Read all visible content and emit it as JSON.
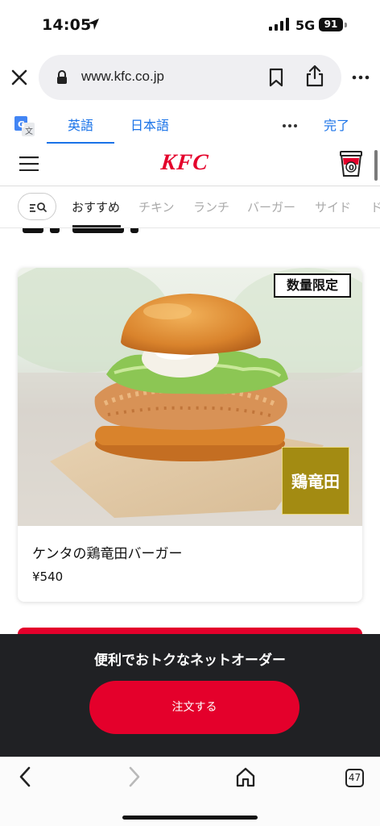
{
  "status": {
    "time": "14:05",
    "network": "5G",
    "battery": "91"
  },
  "browser": {
    "url": "www.kfc.co.jp",
    "tab_count": "47"
  },
  "translate": {
    "tab_english": "英語",
    "tab_japanese": "日本語",
    "done_label": "完了"
  },
  "site": {
    "logo": "KFC",
    "categories": [
      "おすすめ",
      "チキン",
      "ランチ",
      "バーガー",
      "サイド",
      "ド"
    ],
    "active_category": "おすすめ"
  },
  "product": {
    "badge_limited": "数量限定",
    "badge_name": "鶏竜田",
    "name": "ケンタの鶏竜田バーガー",
    "price": "¥540"
  },
  "order_bar": {
    "title": "便利でおトクなネットオーダー",
    "button": "注文する"
  },
  "colors": {
    "brand_red": "#e4002b",
    "link_blue": "#1a73e8",
    "dark_bar": "#202124"
  }
}
